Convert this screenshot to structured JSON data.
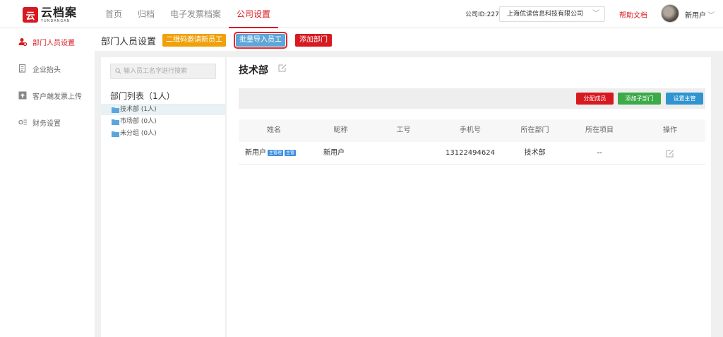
{
  "app": {
    "logo_cn": "云档案",
    "logo_en": "YUNDANGAN"
  },
  "nav": [
    {
      "label": "首页",
      "active": false
    },
    {
      "label": "归档",
      "active": false
    },
    {
      "label": "电子发票档案",
      "active": false
    },
    {
      "label": "公司设置",
      "active": true
    }
  ],
  "header": {
    "company_id": "公司ID:227",
    "company_name": "上海优读信息科技有限公司",
    "help": "帮助文档",
    "username": "新用户"
  },
  "sidebar": {
    "items": [
      {
        "label": "部门人员设置",
        "icon": "users-gear-icon",
        "active": true
      },
      {
        "label": "企业抬头",
        "icon": "document-icon",
        "active": false
      },
      {
        "label": "客户端发票上传",
        "icon": "upload-icon",
        "active": false
      },
      {
        "label": "财务设置",
        "icon": "settings-icon",
        "active": false
      }
    ]
  },
  "content_header": {
    "title": "部门人员设置",
    "qr_invite": "二维码邀请新员工",
    "batch_import": "批量导入员工",
    "add_dept": "添加部门"
  },
  "dept_panel": {
    "search_placeholder": "输入员工名字进行搜索",
    "list_title": "部门列表（1人）",
    "depts": [
      {
        "label": "技术部 (1人)",
        "selected": true
      },
      {
        "label": "市场部 (0人)",
        "selected": false
      },
      {
        "label": "未分组 (0人)",
        "selected": false
      }
    ]
  },
  "main": {
    "dept_name": "技术部",
    "actions": {
      "assign": "分配成员",
      "add_sub": "添加子部门",
      "set_manager": "设置主管"
    },
    "columns": [
      "姓名",
      "昵称",
      "工号",
      "手机号",
      "所在部门",
      "所在项目",
      "操作"
    ],
    "rows": [
      {
        "name": "新用户",
        "tags": [
          "主管理",
          "主管"
        ],
        "nickname": "新用户",
        "employee_no": "",
        "phone": "13122494624",
        "dept": "技术部",
        "project": "--"
      }
    ]
  },
  "colors": {
    "brand": "#d71920",
    "orange": "#f0a10a",
    "blue": "#5da6d8",
    "green": "#3caa48"
  }
}
